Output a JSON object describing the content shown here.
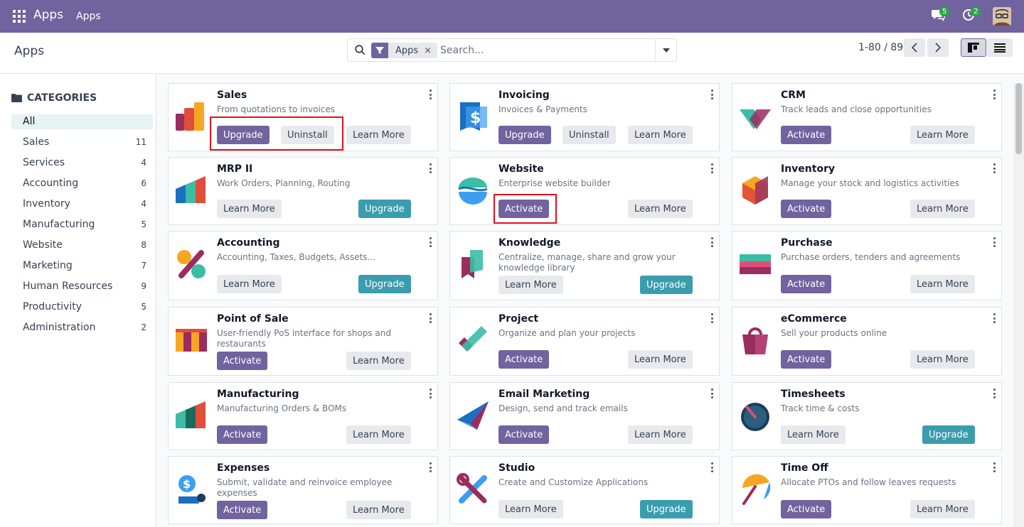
{
  "topbar": {
    "brand": "Apps",
    "menu": "Apps",
    "messages_count": "5",
    "activities_count": "2"
  },
  "control_panel": {
    "title": "Apps",
    "facet": "Apps",
    "facet_remove": "×",
    "search_placeholder": "Search...",
    "pager": "1-80 / 89"
  },
  "sidebar": {
    "heading": "CATEGORIES",
    "items": [
      {
        "label": "All",
        "count": ""
      },
      {
        "label": "Sales",
        "count": "11"
      },
      {
        "label": "Services",
        "count": "4"
      },
      {
        "label": "Accounting",
        "count": "6"
      },
      {
        "label": "Inventory",
        "count": "4"
      },
      {
        "label": "Manufacturing",
        "count": "5"
      },
      {
        "label": "Website",
        "count": "8"
      },
      {
        "label": "Marketing",
        "count": "7"
      },
      {
        "label": "Human Resources",
        "count": "9"
      },
      {
        "label": "Productivity",
        "count": "5"
      },
      {
        "label": "Administration",
        "count": "2"
      }
    ]
  },
  "buttons": {
    "upgrade": "Upgrade",
    "uninstall": "Uninstall",
    "learn_more": "Learn More",
    "activate": "Activate"
  },
  "apps": [
    {
      "name": "Sales",
      "summary": "From quotations to invoices"
    },
    {
      "name": "Invoicing",
      "summary": "Invoices & Payments"
    },
    {
      "name": "CRM",
      "summary": "Track leads and close opportunities"
    },
    {
      "name": "MRP II",
      "summary": "Work Orders, Planning, Routing"
    },
    {
      "name": "Website",
      "summary": "Enterprise website builder"
    },
    {
      "name": "Inventory",
      "summary": "Manage your stock and logistics activities"
    },
    {
      "name": "Accounting",
      "summary": "Accounting, Taxes, Budgets, Assets..."
    },
    {
      "name": "Knowledge",
      "summary": "Centralize, manage, share and grow your knowledge library"
    },
    {
      "name": "Purchase",
      "summary": "Purchase orders, tenders and agreements"
    },
    {
      "name": "Point of Sale",
      "summary": "User-friendly PoS interface for shops and restaurants"
    },
    {
      "name": "Project",
      "summary": "Organize and plan your projects"
    },
    {
      "name": "eCommerce",
      "summary": "Sell your products online"
    },
    {
      "name": "Manufacturing",
      "summary": "Manufacturing Orders & BOMs"
    },
    {
      "name": "Email Marketing",
      "summary": "Design, send and track emails"
    },
    {
      "name": "Timesheets",
      "summary": "Track time & costs"
    },
    {
      "name": "Expenses",
      "summary": "Submit, validate and reinvoice employee expenses"
    },
    {
      "name": "Studio",
      "summary": "Create and Customize Applications"
    },
    {
      "name": "Time Off",
      "summary": "Allocate PTOs and follow leaves requests"
    }
  ],
  "colors": {
    "brand": "#71639e",
    "upgrade": "#3a9dad",
    "highlight": "#e0101a"
  }
}
